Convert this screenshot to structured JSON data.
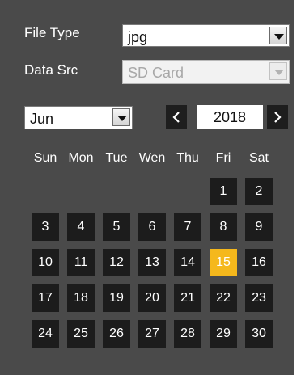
{
  "filters": {
    "file_type_label": "File Type",
    "file_type_value": "jpg",
    "data_src_label": "Data Src",
    "data_src_value": "SD Card"
  },
  "calendar": {
    "month": "Jun",
    "year": "2018",
    "prev_glyph": "<",
    "next_glyph": ">",
    "weekdays": [
      "Sun",
      "Mon",
      "Tue",
      "Wen",
      "Thu",
      "Fri",
      "Sat"
    ],
    "days": [
      "1",
      "2",
      "3",
      "4",
      "5",
      "6",
      "7",
      "8",
      "9",
      "10",
      "11",
      "12",
      "13",
      "14",
      "15",
      "16",
      "17",
      "18",
      "19",
      "20",
      "21",
      "22",
      "23",
      "24",
      "25",
      "26",
      "27",
      "28",
      "29",
      "30"
    ],
    "selected_day": "15",
    "selected_color": "#f5b81c"
  }
}
